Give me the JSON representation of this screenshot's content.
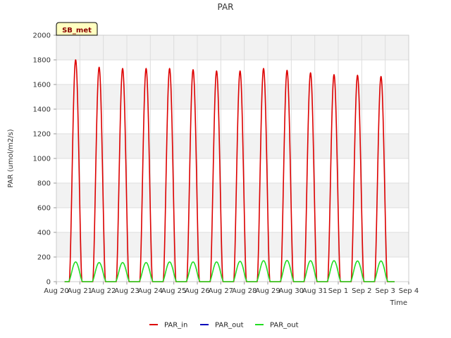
{
  "chart_data": {
    "type": "line",
    "title": "PAR",
    "xlabel": "Time",
    "ylabel": "PAR (umol/m2/s)",
    "ylim": [
      0,
      2000
    ],
    "yticks": [
      0,
      200,
      400,
      600,
      800,
      1000,
      1200,
      1400,
      1600,
      1800,
      2000
    ],
    "xlim": [
      0,
      15
    ],
    "xtick_labels": [
      "Aug 20",
      "Aug 21",
      "Aug 22",
      "Aug 23",
      "Aug 24",
      "Aug 25",
      "Aug 26",
      "Aug 27",
      "Aug 28",
      "Aug 29",
      "Aug 30",
      "Aug 31",
      "Sep 1",
      "Sep 2",
      "Sep 3",
      "Sep 4"
    ],
    "grid": true,
    "legend_position": "bottom",
    "site_tag": "SB_met",
    "series": [
      {
        "name": "PAR_in",
        "color": "#dd0000",
        "data_start": 0.35,
        "data_end": 14.4,
        "day_centers": [
          0.82,
          1.82,
          2.82,
          3.82,
          4.82,
          5.82,
          6.82,
          7.82,
          8.82,
          9.82,
          10.82,
          11.82,
          12.82,
          13.82
        ],
        "daily_peaks": [
          1800,
          1740,
          1730,
          1730,
          1730,
          1720,
          1710,
          1710,
          1730,
          1715,
          1695,
          1680,
          1675,
          1665
        ],
        "half_width_days": 0.27
      },
      {
        "name": "PAR_out",
        "color": "#0000bb",
        "data_start": 0.35,
        "data_end": 14.4,
        "day_centers": [],
        "daily_peaks": [],
        "half_width_days": 0.27
      },
      {
        "name": "PAR_out",
        "color": "#22dd22",
        "data_start": 0.35,
        "data_end": 14.4,
        "day_centers": [
          0.82,
          1.82,
          2.82,
          3.82,
          4.82,
          5.82,
          6.82,
          7.82,
          8.82,
          9.82,
          10.82,
          11.82,
          12.82,
          13.82
        ],
        "daily_peaks": [
          160,
          155,
          155,
          155,
          160,
          160,
          160,
          165,
          170,
          172,
          170,
          170,
          168,
          168
        ],
        "half_width_days": 0.3
      }
    ]
  }
}
